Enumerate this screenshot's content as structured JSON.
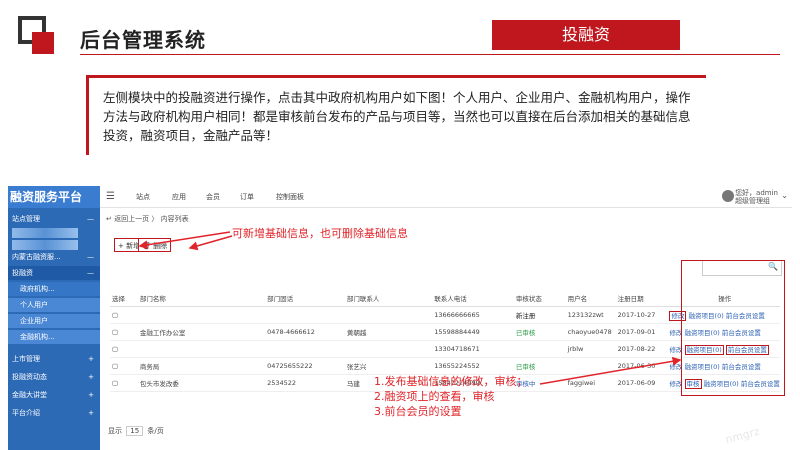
{
  "slide": {
    "title": "后台管理系统",
    "section": "投融资",
    "description": "左侧模块中的投融资进行操作，点击其中政府机构用户如下图！个人用户、企业用户、金融机构用户，操作方法与政府机构用户相同！都是审核前台发布的产品与项目等，当然也可以直接在后台添加相关的基础信息投资，融资项目，金融产品等！"
  },
  "admin": {
    "brand": "融资服务平台",
    "topnav": [
      "站点",
      "应用",
      "会员",
      "订单",
      "控制面板"
    ],
    "user": {
      "greeting": "您好，admin",
      "role": "超级管理组"
    },
    "sidebar": [
      {
        "label": "站点管理"
      },
      {
        "label": "内蒙古融资服..."
      },
      {
        "label": "投融资"
      },
      {
        "label": "政府机构..."
      },
      {
        "label": "个人用户"
      },
      {
        "label": "企业用户"
      },
      {
        "label": "金融机构..."
      },
      {
        "label": "上市管理"
      },
      {
        "label": "投融资动态"
      },
      {
        "label": "金融大讲堂"
      },
      {
        "label": "平台介绍"
      }
    ],
    "breadcrumb": {
      "back": "返回上一页",
      "current": "内容列表"
    },
    "buttons": {
      "new": "新增",
      "delete": "删除"
    },
    "table": {
      "headers": [
        "选择",
        "部门名称",
        "部门固话",
        "部门联系人",
        "联系人电话",
        "审核状态",
        "用户名",
        "注册日期",
        "操作"
      ],
      "rows": [
        {
          "name": "",
          "phone": "",
          "contact": "",
          "mobile": "13666666665",
          "status": "新注册",
          "user": "123132zwt",
          "date": "2017-10-27"
        },
        {
          "name": "金融工作办公室",
          "phone": "0478-4666612",
          "contact": "黄朝越",
          "mobile": "15598884449",
          "status": "已审核",
          "user": "chaoyue0478",
          "date": "2017-09-01"
        },
        {
          "name": "",
          "phone": "",
          "contact": "",
          "mobile": "13304718671",
          "status": "",
          "user": "jrblw",
          "date": "2017-08-22"
        },
        {
          "name": "商务局",
          "phone": "04725655222",
          "contact": "张艺兴",
          "mobile": "13655224552",
          "status": "已审核",
          "user": "",
          "date": "2017-06-30"
        },
        {
          "name": "包头市发改委",
          "phone": "2534522",
          "contact": "马建",
          "mobile": "15847224999",
          "status": "审核中",
          "user": "faggiwei",
          "date": "2017-06-09"
        }
      ],
      "ops": {
        "edit": "修改",
        "items": "融资项目(0)",
        "settings": "前台会员设置",
        "review": "审核"
      }
    },
    "pager": {
      "show": "显示",
      "size": "15",
      "per": "条/页"
    }
  },
  "annotations": {
    "top": "可新增基础信息，也可删除基础信息",
    "list": [
      "1.发布基础信息的修改，审核；",
      "2.融资项上的查看，审核",
      "3.前台会员的设置"
    ]
  },
  "watermark": "nmgrz"
}
